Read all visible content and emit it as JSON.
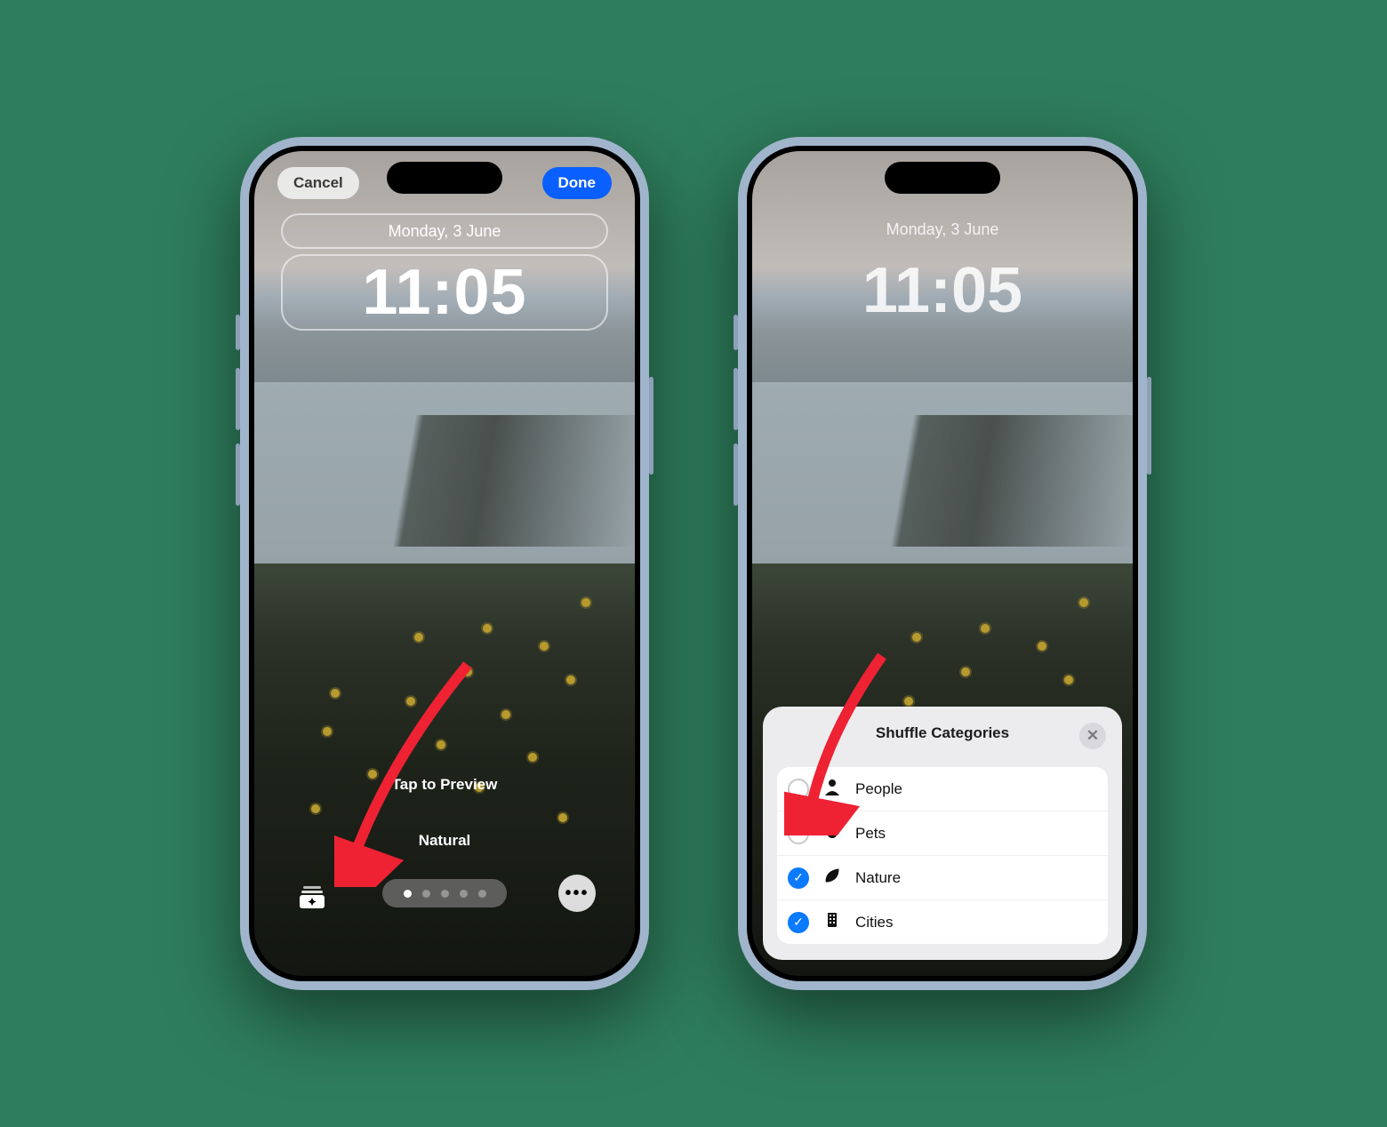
{
  "left": {
    "cancel": "Cancel",
    "done": "Done",
    "date": "Monday, 3 June",
    "time": "11:05",
    "tap_preview": "Tap to Preview",
    "filter": "Natural",
    "page_dots": {
      "count": 5,
      "active": 0
    }
  },
  "right": {
    "date": "Monday, 3 June",
    "time": "11:05",
    "sheet": {
      "title": "Shuffle Categories",
      "close": "✕",
      "categories": [
        {
          "label": "People",
          "checked": false,
          "icon": "person"
        },
        {
          "label": "Pets",
          "checked": false,
          "icon": "paw"
        },
        {
          "label": "Nature",
          "checked": true,
          "icon": "leaf"
        },
        {
          "label": "Cities",
          "checked": true,
          "icon": "building"
        }
      ]
    }
  },
  "colors": {
    "accent_blue": "#0a5fff",
    "check_blue": "#0a7aff"
  }
}
